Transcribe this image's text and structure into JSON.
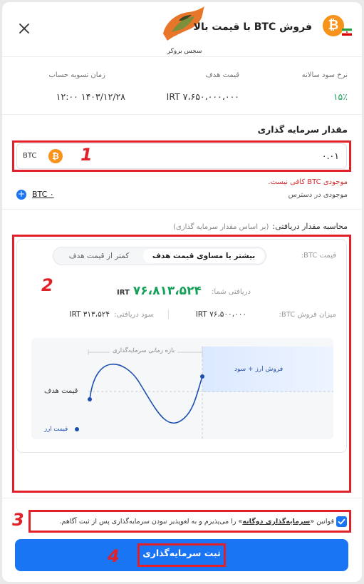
{
  "header": {
    "title": "فروش BTC با قیمت بالا",
    "logo_text": "سجس بروکر",
    "coin_symbol": "₿"
  },
  "stats": [
    {
      "label": "نرخ سود سالانه",
      "value": "۱۵٪"
    },
    {
      "label": "قیمت هدف",
      "value": "۷،۶۵۰،۰۰۰،۰۰۰ IRT"
    },
    {
      "label": "زمان تسویه حساب",
      "value": "۱۴۰۳/۱۲/۲۸ ۱۲:۰۰"
    }
  ],
  "investment": {
    "title": "مقدار سرمایه گذاری",
    "amount": "۰.۰۱",
    "currency": "BTC",
    "error": "موجودی BTC کافی نیست.",
    "available_label": "موجودی در دسترس",
    "available_value": "BTC ۰"
  },
  "calc": {
    "title": "محاسبه مقدار دریافتی:",
    "subtitle": "(بر اساس مقدار سرمایه گذاری)",
    "price_label": "قیمت BTC:",
    "option_above": "بیشتر یا مساوی قیمت هدف",
    "option_below": "کمتر از قیمت هدف",
    "received_label": "دریافتی شما:",
    "received_value": "۷۶،۸۱۳،۵۲۴",
    "received_unit": "IRT",
    "sale_label": "میزان فروش BTC:",
    "sale_value": "۷۶،۵۰۰،۰۰۰ IRT",
    "profit_label": "سود دریافتی:",
    "profit_value": "۳۱۳،۵۲۴ IRT"
  },
  "graph": {
    "period_label": "بازه زمانی سرمایه‌گذاری",
    "sell_label": "فروش ارز + سود",
    "target_label": "قیمت هدف",
    "currency_price_label": "قیمت ارز"
  },
  "terms": {
    "prefix": "قوانین «",
    "link": "سرمایه‌گذاری دوگانه",
    "suffix": "» را می‌پذیرم و به لغوپذیر نبودن سرمایه‌گذاری پس از ثبت آگاهم."
  },
  "submit_label": "ثبت سرمایه‌گذاری",
  "annotations": [
    "1",
    "2",
    "3",
    "4"
  ],
  "colors": {
    "accent": "#1a75f5",
    "annotation": "#e1202a",
    "positive": "#16a05a",
    "btc": "#f7931a"
  }
}
